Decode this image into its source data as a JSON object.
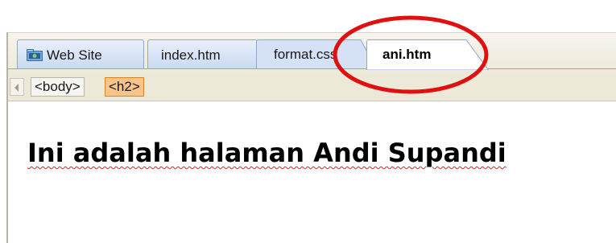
{
  "tabs": [
    {
      "label": "Web Site",
      "icon": "folder-icon",
      "active": false
    },
    {
      "label": "index.htm",
      "active": false
    },
    {
      "label": "format.css",
      "active": false
    },
    {
      "label": "ani.htm",
      "active": true
    }
  ],
  "tag_selector": {
    "items": [
      "<body>",
      "<h2>"
    ],
    "selected": "<h2>"
  },
  "document": {
    "heading": "Ini adalah halaman Andi Supandi"
  },
  "annotation": {
    "color": "#e01010",
    "target": "ani.htm tab"
  },
  "colors": {
    "tab_inactive": "#c9d8f0",
    "tag_selected": "#f9c38a",
    "spell_underline": "#e02020"
  }
}
